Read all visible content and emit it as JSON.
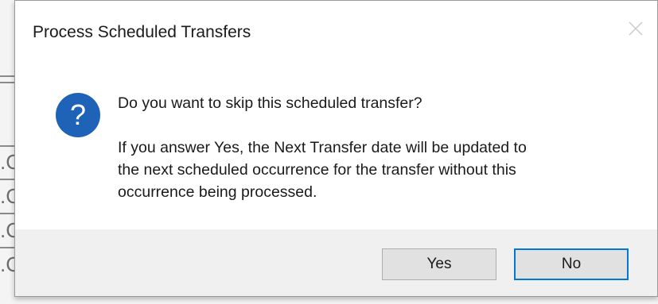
{
  "dialog": {
    "title": "Process Scheduled Transfers",
    "close_icon": "close-icon",
    "icon": "question-icon",
    "message": "Do you want to skip this scheduled transfer?",
    "detail_lines": [
      "If you answer Yes, the Next Transfer date will be updated to",
      "the next scheduled occurrence for the transfer without this",
      "occurrence being processed."
    ],
    "buttons": {
      "yes": "Yes",
      "no": "No"
    },
    "accent_color": "#0078d7",
    "icon_color": "#1e63b8"
  },
  "background": {
    "fragments": [
      ".C",
      ".C",
      ".C",
      ".C"
    ]
  }
}
